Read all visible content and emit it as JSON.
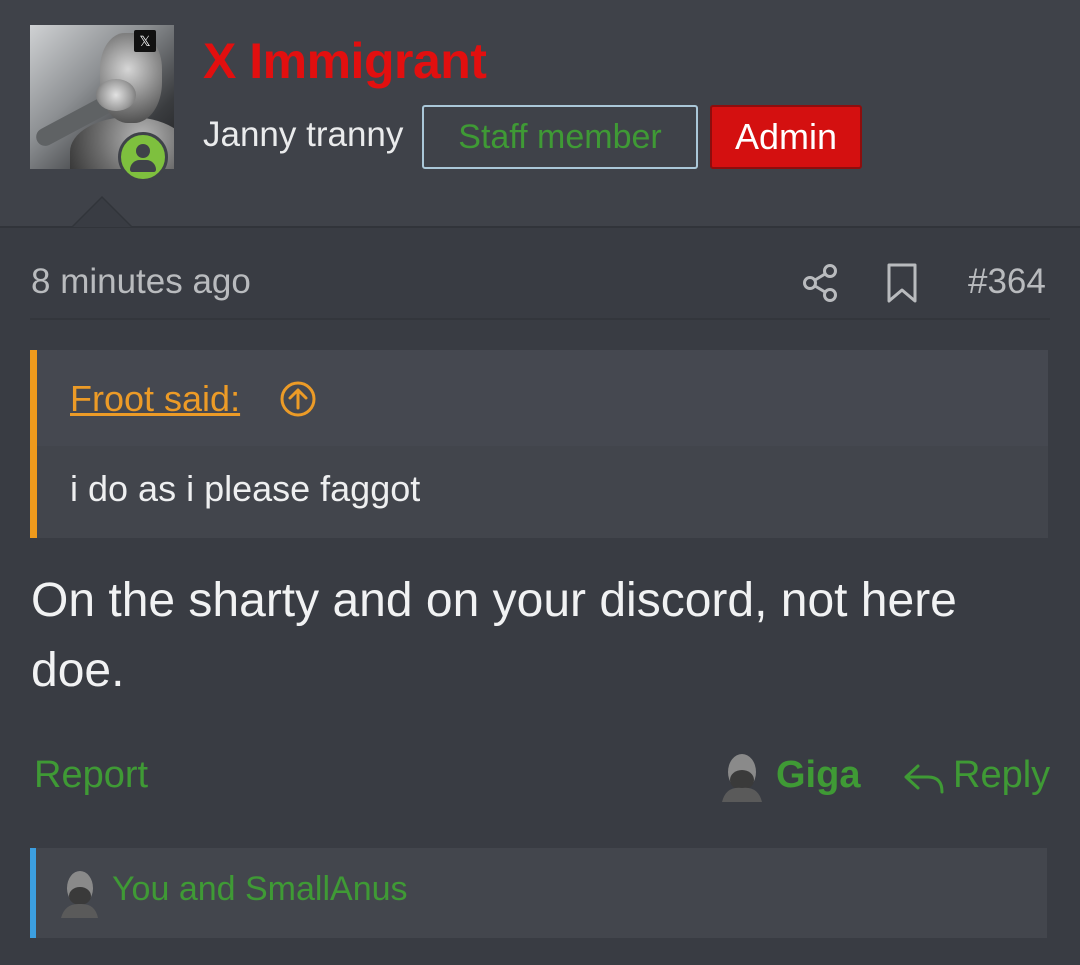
{
  "post": {
    "author": {
      "username": "X Immigrant",
      "user_title": "Janny tranny",
      "badges": {
        "staff": "Staff member",
        "admin": "Admin"
      },
      "avatar_badge_glyph": "𝕏",
      "status": "online"
    },
    "meta": {
      "time": "8 minutes ago",
      "post_number": "#364",
      "icons": [
        "share-icon",
        "bookmark-icon"
      ]
    },
    "quote": {
      "author_link": "Froot said:",
      "text": "i do as i please faggot",
      "jump_icon": "arrow-up-circle-icon"
    },
    "body": "On the sharty and on your discord, not here doe.",
    "actions": {
      "report": "Report",
      "reaction": "Giga",
      "reply": "Reply"
    },
    "reactions_summary": "You and SmallAnus"
  },
  "colors": {
    "background": "#393c43",
    "username": "#e20f0f",
    "accent_green": "#3f9a35",
    "quote_border": "#ef9a1c",
    "reactions_border": "#3c9fe0",
    "admin_badge": "#d41010"
  }
}
